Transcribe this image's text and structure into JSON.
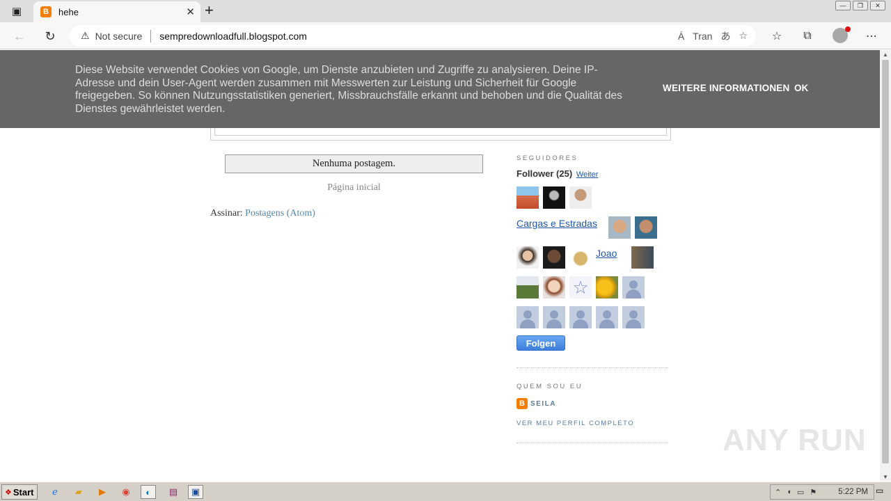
{
  "browser": {
    "tab_title": "hehe",
    "security_label": "Not secure",
    "url": "sempredownloadfull.blogspot.com",
    "read_aloud": "Á",
    "translate_label": "Tran"
  },
  "cookie_notice": {
    "message": "Diese Website verwendet Cookies von Google, um Dienste anzubieten und Zugriffe zu analysieren. Deine IP-Adresse und dein User-Agent werden zusammen mit Messwerten zur Leistung und Sicherheit für Google freigegeben. So können Nutzungsstatistiken generiert, Missbrauchsfälle erkannt und behoben und die Qualität des Dienstes gewährleistet werden.",
    "more_info": "WEITERE INFORMATIONEN",
    "ok": "OK"
  },
  "main": {
    "no_posts": "Nenhuma postagem.",
    "home_link": "Página inicial",
    "subscribe_label": "Assinar:",
    "subscribe_link": "Postagens (Atom)"
  },
  "sidebar": {
    "followers_heading": "SEGUIDORES",
    "followers_count_label": "Follower (25)",
    "followers_more": "Weiter",
    "broken_avatar_1": "Cargas e Estradas",
    "broken_avatar_2": "Joao",
    "follow_button": "Folgen",
    "about_heading": "QUEM SOU EU",
    "profile_name": "SEILA",
    "profile_link": "VER MEU PERFIL COMPLETO"
  },
  "watermark": "ANY RUN",
  "taskbar": {
    "start": "Start",
    "clock": "5:22 PM"
  }
}
